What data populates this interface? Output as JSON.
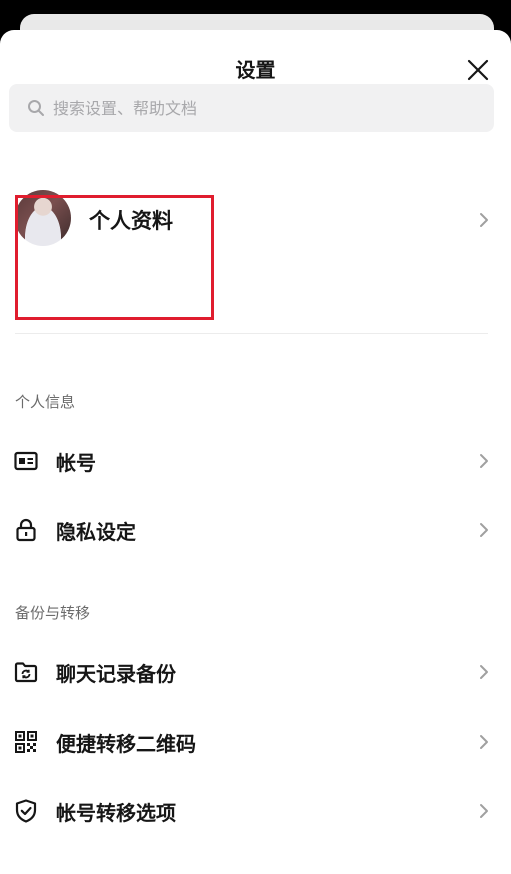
{
  "header": {
    "title": "设置"
  },
  "search": {
    "placeholder": "搜索设置、帮助文档"
  },
  "profile": {
    "label": "个人资料"
  },
  "sections": {
    "personal": {
      "label": "个人信息",
      "items": [
        {
          "label": "帐号",
          "icon": "id-card-icon"
        },
        {
          "label": "隐私设定",
          "icon": "lock-icon"
        }
      ]
    },
    "backup": {
      "label": "备份与转移",
      "items": [
        {
          "label": "聊天记录备份",
          "icon": "folder-sync-icon"
        },
        {
          "label": "便捷转移二维码",
          "icon": "qr-code-icon"
        },
        {
          "label": "帐号转移选项",
          "icon": "shield-check-icon"
        }
      ]
    }
  },
  "colors": {
    "highlight": "#e01d2e",
    "text": "#161616",
    "section": "#6b6b6b"
  }
}
